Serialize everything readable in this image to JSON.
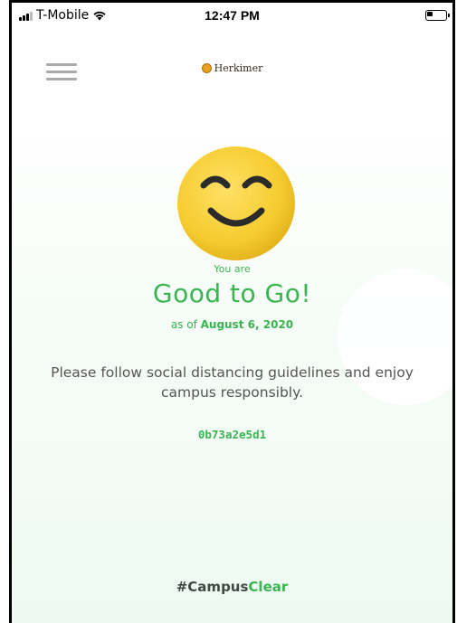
{
  "status_bar": {
    "carrier": "T-Mobile",
    "time": "12:47 PM",
    "signal_bars_active": 3,
    "signal_bars_total": 4,
    "battery_level": 0.35
  },
  "header": {
    "brand_name": "Herkimer",
    "menu_icon": "hamburger-menu-icon",
    "logo_icon": "herkimer-logo-icon"
  },
  "status": {
    "icon": "smiley-face-icon",
    "prefix": "You are",
    "title": "Good to Go!",
    "as_of_label": "as of",
    "date": "August 6, 2020"
  },
  "message": "Please follow social distancing guidelines and enjoy campus responsibly.",
  "code": "0b73a2e5d1",
  "footer": {
    "hashtag_part1": "#Campus",
    "hashtag_part2": "Clear"
  },
  "colors": {
    "accent": "#3bb552",
    "text": "#555555",
    "smiley_face": "#f5cc2f"
  }
}
